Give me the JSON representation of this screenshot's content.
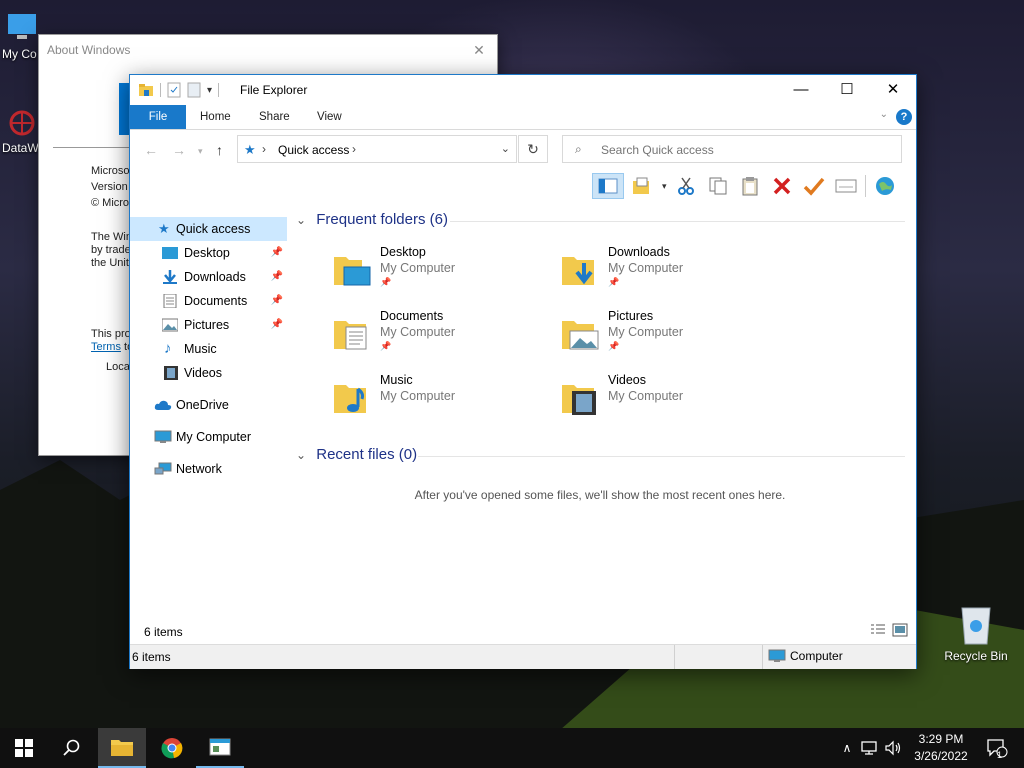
{
  "desktop": {
    "icons": [
      {
        "label": "My Co"
      },
      {
        "label": "DataW"
      },
      {
        "label": "Recycle Bin"
      }
    ]
  },
  "about": {
    "title": "About Windows",
    "lines": [
      "Microsof",
      "Version",
      "© Micro"
    ],
    "para1": [
      "The Win",
      "by trade",
      "the Unit"
    ],
    "para2": "This pro",
    "terms_link": "Terms",
    "terms_after": "to",
    "local": "Local"
  },
  "explorer": {
    "title": "File Explorer",
    "ribbon_tabs": {
      "file": "File",
      "home": "Home",
      "share": "Share",
      "view": "View"
    },
    "address": {
      "location": "Quick access"
    },
    "search": {
      "placeholder": "Search Quick access"
    },
    "nav": {
      "quick_access": "Quick access",
      "desktop": "Desktop",
      "downloads": "Downloads",
      "documents": "Documents",
      "pictures": "Pictures",
      "music": "Music",
      "videos": "Videos",
      "onedrive": "OneDrive",
      "my_computer": "My Computer",
      "network": "Network"
    },
    "frequent": {
      "header": "Frequent folders (6)",
      "folders": [
        {
          "name": "Desktop",
          "location": "My Computer",
          "pinned": true
        },
        {
          "name": "Downloads",
          "location": "My Computer",
          "pinned": true
        },
        {
          "name": "Documents",
          "location": "My Computer",
          "pinned": true
        },
        {
          "name": "Pictures",
          "location": "My Computer",
          "pinned": true
        },
        {
          "name": "Music",
          "location": "My Computer",
          "pinned": false
        },
        {
          "name": "Videos",
          "location": "My Computer",
          "pinned": false
        }
      ]
    },
    "recent": {
      "header": "Recent files (0)",
      "empty_message": "After you've opened some files, we'll show the most recent ones here."
    },
    "item_count": "6 items",
    "status": {
      "left": "6 items",
      "right": "Computer"
    }
  },
  "taskbar": {
    "time": "3:29 PM",
    "date": "3/26/2022",
    "notification_count": "1"
  },
  "colors": {
    "accent": "#1979ca",
    "header_text": "#1e3287",
    "selection": "#cce8ff",
    "folder": "#f2c94c"
  }
}
